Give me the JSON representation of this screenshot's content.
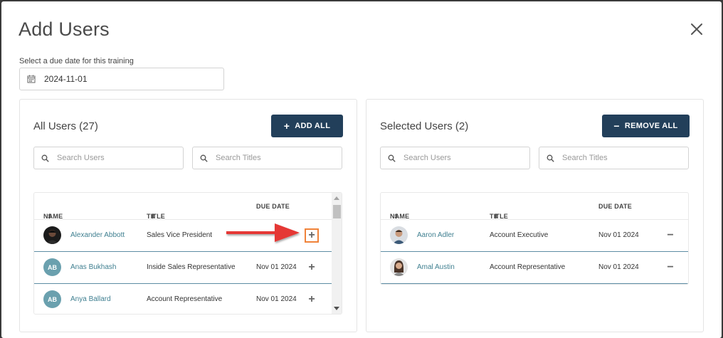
{
  "modal": {
    "title": "Add Users"
  },
  "due_date": {
    "label": "Select a due date for this training",
    "value": "2024-11-01"
  },
  "all_users": {
    "title": "All Users (27)",
    "add_all_label": "ADD ALL",
    "search_users_placeholder": "Search Users",
    "search_titles_placeholder": "Search Titles",
    "columns": {
      "name": "NAME",
      "title": "TITLE",
      "due": "DUE DATE"
    },
    "rows": [
      {
        "name": "Alexander Abbott",
        "title": "Sales Vice President",
        "due": "",
        "initials": ""
      },
      {
        "name": "Anas Bukhash",
        "title": "Inside Sales Representative",
        "due": "Nov 01 2024",
        "initials": "AB"
      },
      {
        "name": "Anya Ballard",
        "title": "Account Representative",
        "due": "Nov 01 2024",
        "initials": "AB"
      }
    ]
  },
  "selected_users": {
    "title": "Selected Users (2)",
    "remove_all_label": "REMOVE ALL",
    "search_users_placeholder": "Search Users",
    "search_titles_placeholder": "Search Titles",
    "columns": {
      "name": "NAME",
      "title": "TITLE",
      "due": "DUE DATE"
    },
    "rows": [
      {
        "name": "Aaron Adler",
        "title": "Account Executive",
        "due": "Nov 01 2024"
      },
      {
        "name": "Amal Austin",
        "title": "Account Representative",
        "due": "Nov 01 2024"
      }
    ]
  },
  "colors": {
    "button": "#223f5a",
    "link": "#3f7f90",
    "highlight": "#f0833a",
    "arrow": "#e53935",
    "avatar": "#6aa0ae"
  }
}
